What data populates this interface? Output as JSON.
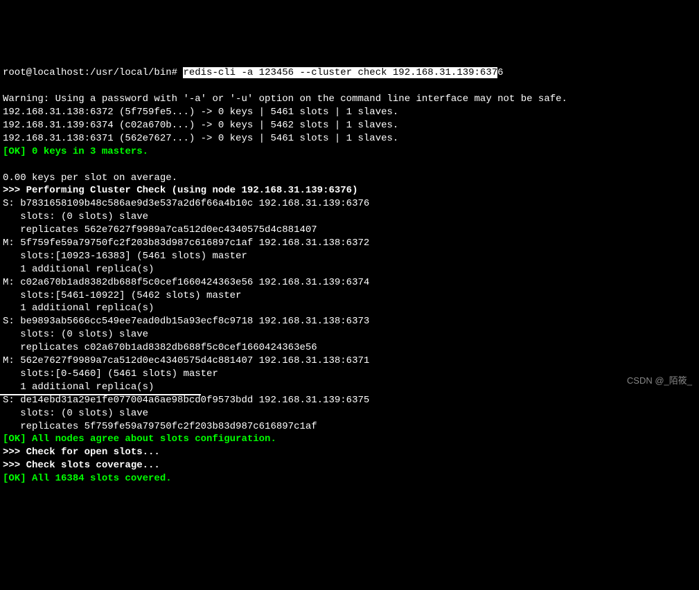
{
  "prompt": "root@localhost:/usr/local/bin# ",
  "command_highlight": "redis-cli -a 123456 --cluster check 192.168.31.139:637",
  "command_tail": "6",
  "warning": "Warning: Using a password with '-a' or '-u' option on the command line interface may not be safe.",
  "summary": [
    "192.168.31.138:6372 (5f759fe5...) -> 0 keys | 5461 slots | 1 slaves.",
    "192.168.31.139:6374 (c02a670b...) -> 0 keys | 5462 slots | 1 slaves.",
    "192.168.31.138:6371 (562e7627...) -> 0 keys | 5461 slots | 1 slaves."
  ],
  "ok1_prefix": "[OK] ",
  "ok1_text": "0 keys in 3 masters.",
  "avg": "0.00 keys per slot on average.",
  "check_header": ">>> Performing Cluster Check (using node 192.168.31.139:6376)",
  "nodes": [
    "S: b7831658109b48c586ae9d3e537a2d6f66a4b10c 192.168.31.139:6376",
    "   slots: (0 slots) slave",
    "   replicates 562e7627f9989a7ca512d0ec4340575d4c881407",
    "M: 5f759fe59a79750fc2f203b83d987c616897c1af 192.168.31.138:6372",
    "   slots:[10923-16383] (5461 slots) master",
    "   1 additional replica(s)",
    "M: c02a670b1ad8382db688f5c0cef1660424363e56 192.168.31.139:6374",
    "   slots:[5461-10922] (5462 slots) master",
    "   1 additional replica(s)",
    "S: be9893ab5666cc549ee7ead0db15a93ecf8c9718 192.168.31.138:6373",
    "   slots: (0 slots) slave",
    "   replicates c02a670b1ad8382db688f5c0cef1660424363e56",
    "M: 562e7627f9989a7ca512d0ec4340575d4c881407 192.168.31.138:6371",
    "   slots:[0-5460] (5461 slots) master",
    "   1 additional replica(s)",
    "S: de14ebd31a29e1fe077004a6ae98bcd0f9573bdd 192.168.31.139:6375",
    "   slots: (0 slots) slave",
    "   replicates 5f759fe59a79750fc2f203b83d987c616897c1af"
  ],
  "ok2": "[OK] All nodes agree about slots configuration.",
  "check_open": ">>> Check for open slots...",
  "check_coverage": ">>> Check slots coverage...",
  "ok3": "[OK] All 16384 slots covered.",
  "watermark": "CSDN @_陌筱_"
}
